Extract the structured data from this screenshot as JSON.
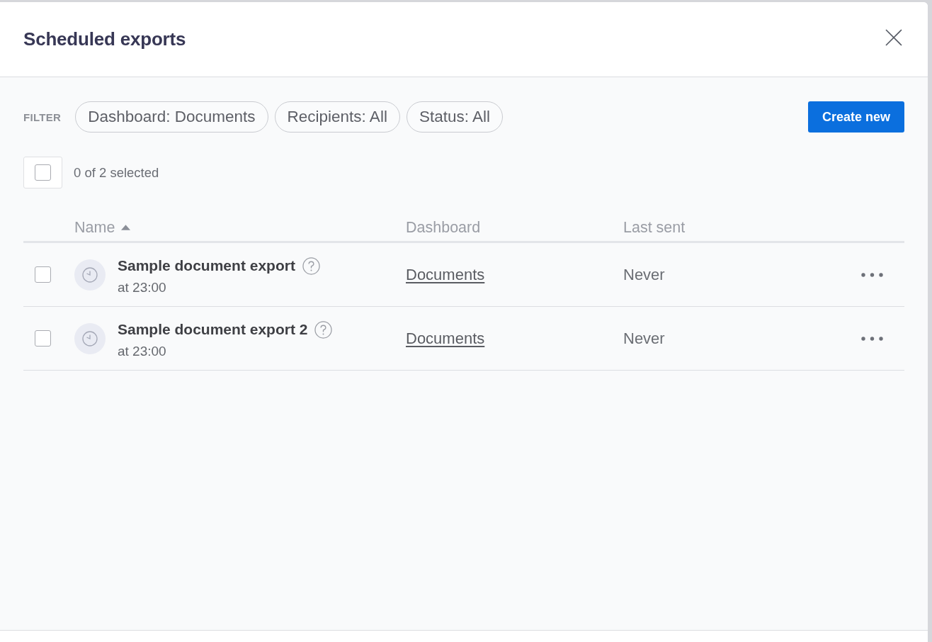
{
  "modal": {
    "title": "Scheduled exports"
  },
  "filter": {
    "label": "FILTER",
    "chips": [
      "Dashboard: Documents",
      "Recipients: All",
      "Status: All"
    ]
  },
  "create_button": "Create new",
  "selection": {
    "checked": false,
    "text": "0 of 2 selected"
  },
  "table": {
    "columns": [
      {
        "label": "Name",
        "sorted": true
      },
      {
        "label": "Dashboard",
        "sorted": false
      },
      {
        "label": "Last sent",
        "sorted": false
      }
    ],
    "rows": [
      {
        "checked": false,
        "name": "Sample document export",
        "schedule": "at 23:00",
        "dashboard": "Documents",
        "last_sent": "Never"
      },
      {
        "checked": false,
        "name": "Sample document export 2",
        "schedule": "at 23:00",
        "dashboard": "Documents",
        "last_sent": "Never"
      }
    ]
  }
}
